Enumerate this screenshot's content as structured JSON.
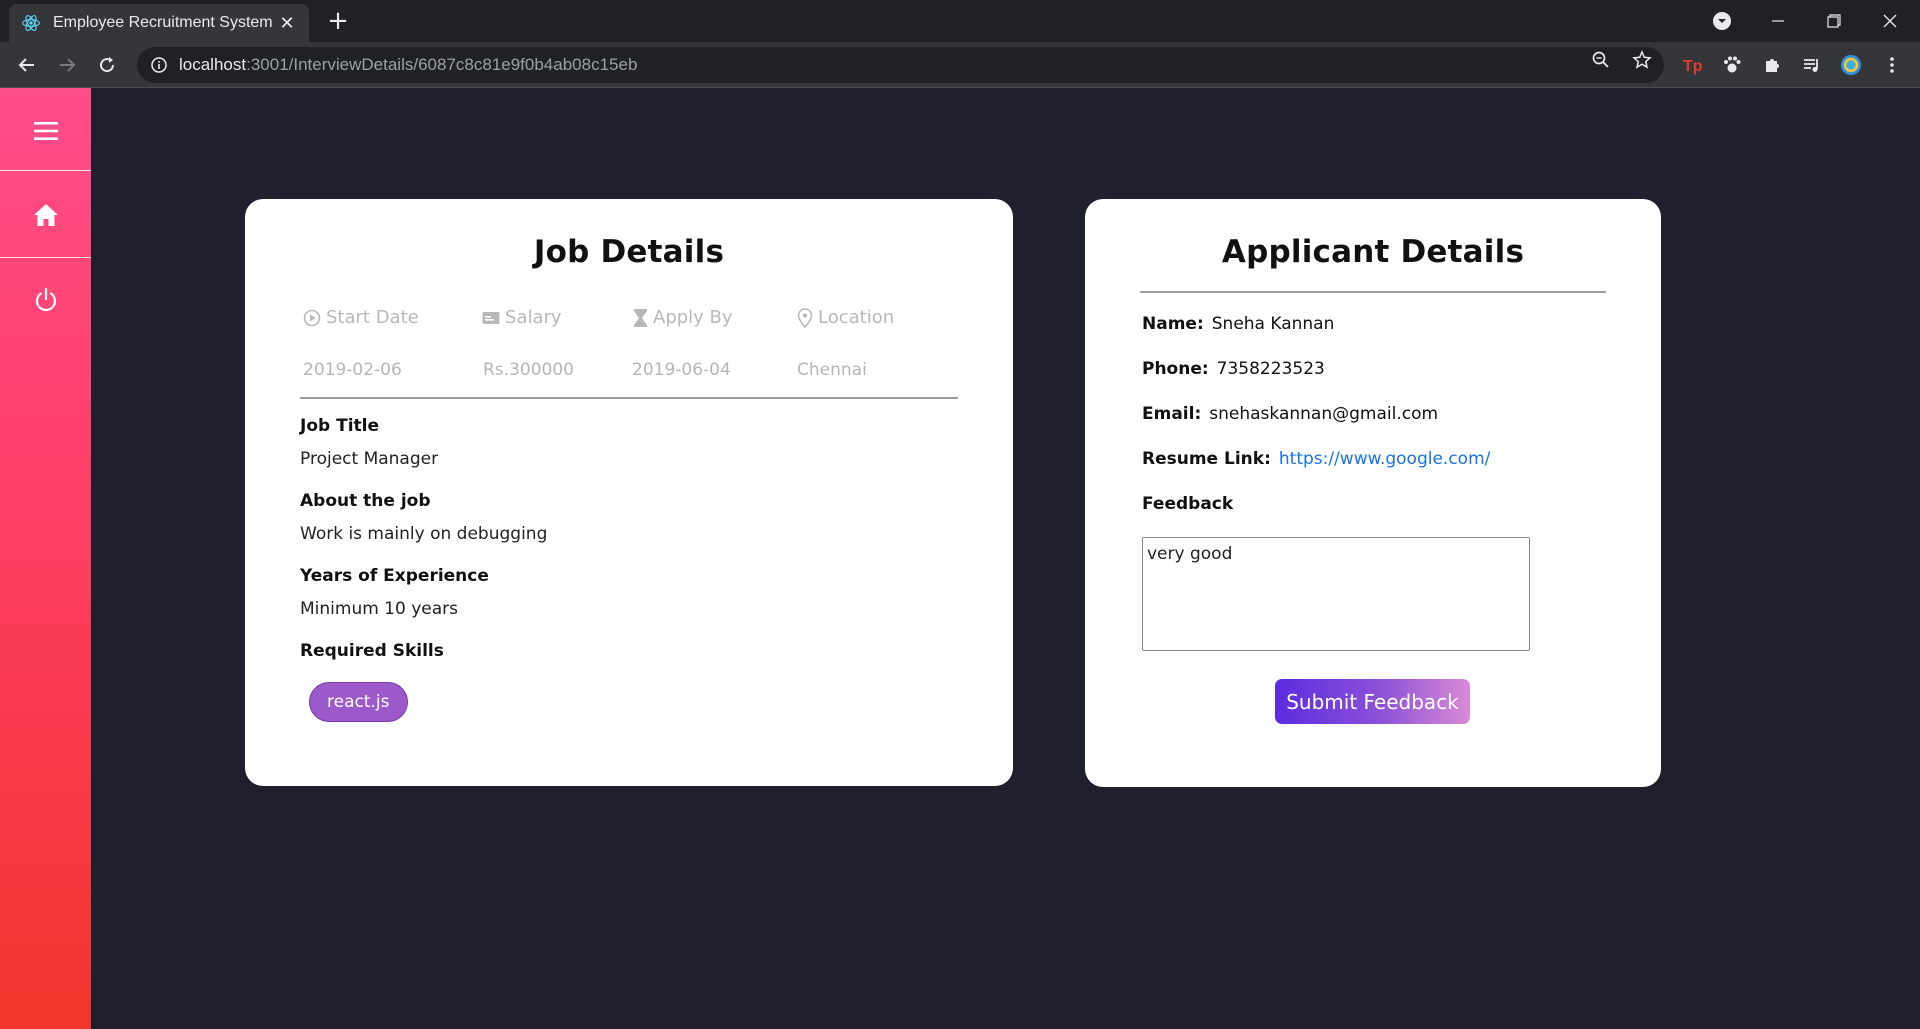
{
  "browser": {
    "tab_title": "Employee Recruitment System",
    "tab_close": "✕",
    "new_tab": "+",
    "url_host": "localhost",
    "url_path": ":3001/InterviewDetails/6087c8c81e9f0b4ab08c15eb"
  },
  "job": {
    "title": "Job Details",
    "meta": [
      {
        "label": "Start Date",
        "icon": "play-circle-icon",
        "value": "2019-02-06"
      },
      {
        "label": "Salary",
        "icon": "money-icon",
        "value": "Rs.300000"
      },
      {
        "label": "Apply By",
        "icon": "hourglass-icon",
        "value": "2019-06-04"
      },
      {
        "label": "Location",
        "icon": "location-pin-icon",
        "value": "Chennai"
      }
    ],
    "job_title_label": "Job Title",
    "job_title": "Project Manager",
    "about_label": "About the job",
    "about": "Work is mainly on debugging",
    "experience_label": "Years of Experience",
    "experience": "Minimum 10 years",
    "skills_label": "Required Skills",
    "skills": [
      "react.js"
    ]
  },
  "applicant": {
    "title": "Applicant Details",
    "name_label": "Name:",
    "name": "Sneha Kannan",
    "phone_label": "Phone:",
    "phone": "7358223523",
    "email_label": "Email:",
    "email": "snehaskannan@gmail.com",
    "resume_label": "Resume Link:",
    "resume": "https://www.google.com/",
    "feedback_label": "Feedback",
    "feedback_value": "very good",
    "submit_label": "Submit Feedback"
  },
  "colors": {
    "background": "#1f1f2e",
    "sidebar_top": "#ff4d8a",
    "sidebar_bottom": "#f2352d",
    "chip": "#9b59c9",
    "link": "#1a73e8"
  }
}
